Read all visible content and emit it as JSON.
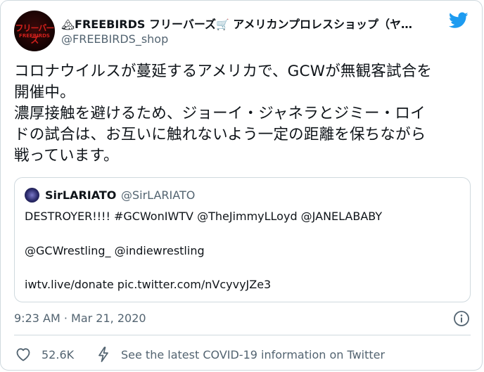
{
  "author": {
    "avatar_top_text": "フリーバーズ",
    "avatar_bottom_text": "FREEBIRDS",
    "name_prefix_emoji": "🏔",
    "name_main": "FREEBIRDS フリーバーズ",
    "name_cart_emoji": "🛒",
    "name_suffix": " アメリカンプロレスショップ（ヤ…",
    "handle": "@FREEBIRDS_shop"
  },
  "tweet": {
    "lines": [
      "コロナウイルスが蔓延するアメリカで、GCWが無観客試合を",
      "開催中。",
      "濃厚接触を避けるため、ジョーイ・ジャネラとジミー・ロイ",
      "ドの試合は、お互いに触れないよう一定の距離を保ちながら",
      "戦っています。"
    ]
  },
  "quote": {
    "name": "SirLARIATO",
    "handle": "@SirLARIATO",
    "line1": "DESTROYER!!!! #GCWonIWTV @TheJimmyLLoyd @JANELABABY",
    "line2": "@GCWrestling_ @indiewrestling",
    "line3": "iwtv.live/donate pic.twitter.com/nVcyvyJZe3"
  },
  "meta": {
    "timestamp": "9:23 AM · Mar 21, 2020"
  },
  "actions": {
    "like_count": "52.6K",
    "covid_link": "See the latest COVID-19 information on Twitter"
  },
  "colors": {
    "primary_text": "#0f1419",
    "secondary_text": "#536471",
    "border": "#cfd9de",
    "twitter_blue": "#1d9bf0"
  },
  "icons": [
    "twitter-bird-icon",
    "info-icon",
    "heart-icon",
    "lightning-bolt-icon"
  ]
}
